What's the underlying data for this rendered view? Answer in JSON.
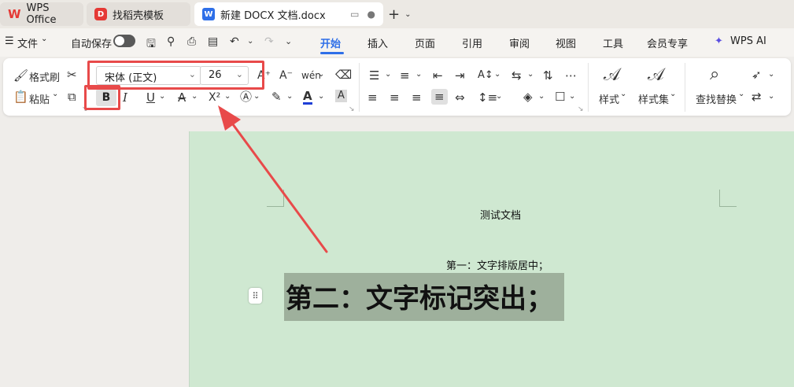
{
  "tabs": {
    "wps": "WPS Office",
    "templates": "找稻壳模板",
    "document": "新建 DOCX 文档.docx"
  },
  "menu": {
    "file": "文件",
    "autosave": "自动保存",
    "tabs": [
      "开始",
      "插入",
      "页面",
      "引用",
      "审阅",
      "视图",
      "工具",
      "会员专享",
      "WPS AI"
    ],
    "active_tab": "开始"
  },
  "ribbon": {
    "format_painter": "格式刷",
    "paste": "粘贴",
    "font_name": "宋体 (正文)",
    "font_size": "26",
    "styles": "样式",
    "style_set": "样式集",
    "find_replace": "查找替换",
    "bold": "B",
    "italic": "I",
    "underline": "U",
    "strike": "A",
    "superscript": "X²",
    "font_color": "A",
    "font_grow": "A⁺",
    "font_shrink": "A⁻",
    "phonetic": "wén"
  },
  "document": {
    "title": "测试文档",
    "line1": "第一：文字排版居中；",
    "line2": "第二：文字标记突出；"
  },
  "colors": {
    "accent": "#2e6fe8",
    "annotation_red": "#e84a4a",
    "page_green": "#cfe8d1",
    "highlight": "#9eb09c"
  }
}
